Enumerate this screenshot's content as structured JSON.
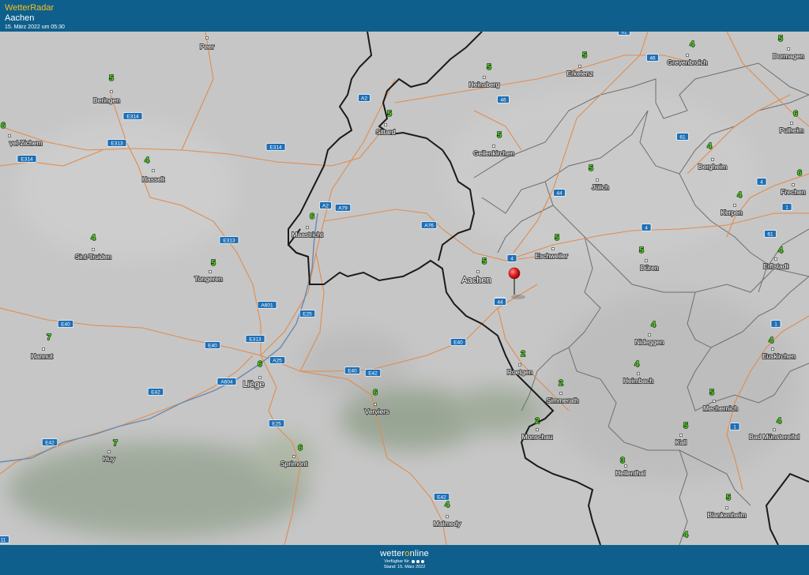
{
  "header": {
    "brand": "WetterRadar",
    "location": "Aachen",
    "timestamp": "15. März 2022 um 05:30"
  },
  "footer": {
    "logo_left": "wetter",
    "logo_o": "o",
    "logo_right": "nline",
    "available_label": "Verfügbar für",
    "as_of": "Stand: 15. März 2022"
  },
  "colors": {
    "bar": "#0f5f8c",
    "brand_accent": "#f3c11d",
    "temperature": "#59d52e",
    "road": "#e08c4e",
    "border": "#1a1a1a",
    "district": "#6e6e6e",
    "road_shield": "#1f6fb5",
    "pin": "#e01b1b"
  },
  "pin_icon": "map-pin-icon",
  "cities": [
    {
      "name": "Peer",
      "temp": ""
    },
    {
      "name": "Beringen",
      "temp": "5"
    },
    {
      "name": "vel-Zichem",
      "temp": "6"
    },
    {
      "name": "Hasselt",
      "temp": "4"
    },
    {
      "name": "Sint-Truiden",
      "temp": "4"
    },
    {
      "name": "Tongeren",
      "temp": "5"
    },
    {
      "name": "Hannut",
      "temp": "7"
    },
    {
      "name": "Liège",
      "temp": "6"
    },
    {
      "name": "Huy",
      "temp": "7"
    },
    {
      "name": "Sprimont",
      "temp": "6"
    },
    {
      "name": "Verviers",
      "temp": "6"
    },
    {
      "name": "Malmedy",
      "temp": "4"
    },
    {
      "name": "Maastricht",
      "temp": "6"
    },
    {
      "name": "Sittard",
      "temp": "5"
    },
    {
      "name": "Heinsberg",
      "temp": "5"
    },
    {
      "name": "Geilenkirchen",
      "temp": "5"
    },
    {
      "name": "Erkelenz",
      "temp": "5"
    },
    {
      "name": "Grevenbroich",
      "temp": "4"
    },
    {
      "name": "Dormagen",
      "temp": "5"
    },
    {
      "name": "Pulheim",
      "temp": "6"
    },
    {
      "name": "Bergheim",
      "temp": "4"
    },
    {
      "name": "Frechen",
      "temp": "6"
    },
    {
      "name": "Jülich",
      "temp": "5"
    },
    {
      "name": "Kerpen",
      "temp": "4"
    },
    {
      "name": "Erftstadt",
      "temp": "4"
    },
    {
      "name": "Aachen",
      "temp": "5"
    },
    {
      "name": "Eschweiler",
      "temp": "5"
    },
    {
      "name": "Düren",
      "temp": "5"
    },
    {
      "name": "Nideggen",
      "temp": "4"
    },
    {
      "name": "Euskirchen",
      "temp": "4"
    },
    {
      "name": "Roetgen",
      "temp": "2"
    },
    {
      "name": "Simmerath",
      "temp": "2"
    },
    {
      "name": "Heimbach",
      "temp": "4"
    },
    {
      "name": "Monschau",
      "temp": "2"
    },
    {
      "name": "Mechernich",
      "temp": "5"
    },
    {
      "name": "Bad Münstereifel",
      "temp": "4"
    },
    {
      "name": "Kall",
      "temp": "5"
    },
    {
      "name": "Hellenthal",
      "temp": "3"
    },
    {
      "name": "Blankenheim",
      "temp": "5"
    },
    {
      "name": "",
      "temp": "4"
    }
  ],
  "roads": [
    "61",
    "46",
    "A2",
    "46",
    "E314",
    "E313",
    "E314",
    "E314",
    "61",
    "4",
    "A2",
    "A79",
    "44",
    "1",
    "E313",
    "A76",
    "4",
    "4",
    "61",
    "4",
    "44",
    "E25",
    "A601",
    "E40",
    "E313",
    "E40",
    "E40",
    "1",
    "A25",
    "A604",
    "E40",
    "E42",
    "E42",
    "1",
    "E42",
    "E25",
    "E42",
    "11"
  ]
}
